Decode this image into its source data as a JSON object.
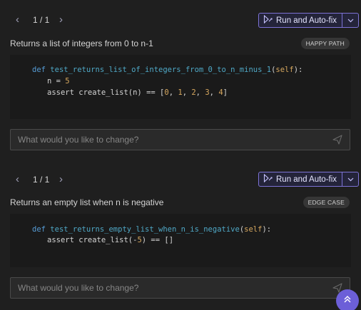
{
  "nav": {
    "prev_icon": "chevron-left-icon",
    "next_icon": "chevron-right-icon"
  },
  "cards": [
    {
      "pager": "1 / 1",
      "run_label": "Run and Auto-fix",
      "description": "Returns a list of integers from 0 to n-1",
      "badge": "HAPPY PATH",
      "code": {
        "def_kw": "def",
        "func_name": "test_returns_list_of_integers_from_0_to_n_minus_1",
        "open_paren": "(",
        "self_kw": "self",
        "close_sig": "):",
        "line2_pre": "n = ",
        "line2_num": "5",
        "line3_pre": "assert create_list(n) == [",
        "n0": "0",
        "n1": "1",
        "n2": "2",
        "n3": "3",
        "n4": "4",
        "sep": ", ",
        "close_bracket": "]"
      },
      "input_placeholder": "What would you like to change?"
    },
    {
      "pager": "1 / 1",
      "run_label": "Run and Auto-fix",
      "description_pre": "Returns an empty list when ",
      "description_var": "n",
      "description_post": " is negative",
      "badge": "EDGE CASE",
      "code": {
        "def_kw": "def",
        "func_name": "test_returns_empty_list_when_n_is_negative",
        "open_paren": "(",
        "self_kw": "self",
        "close_sig": "):",
        "line2_pre": "assert create_list(-",
        "line2_num": "5",
        "line2_post": ") == []"
      },
      "input_placeholder": "What would you like to change?"
    }
  ],
  "fab_icon": "double-chevron-up-icon",
  "colors": {
    "accent": "#7d73d6",
    "fab": "#6c5fd8",
    "background": "#1f1f1f"
  }
}
